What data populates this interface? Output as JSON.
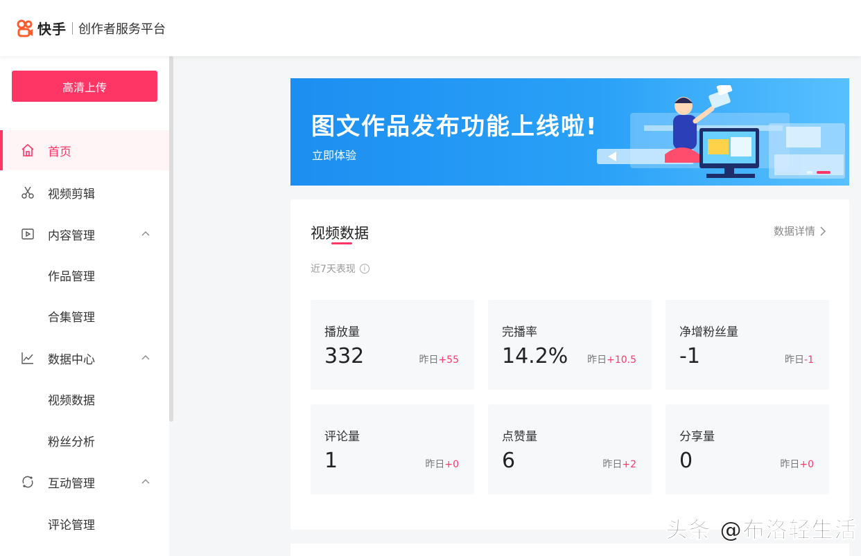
{
  "header": {
    "brand": "快手",
    "platform": "创作者服务平台"
  },
  "sidebar": {
    "upload_label": "高清上传",
    "items": [
      {
        "label": "首页",
        "icon": "home-icon",
        "active": true
      },
      {
        "label": "视频剪辑",
        "icon": "scissors-icon"
      },
      {
        "label": "内容管理",
        "icon": "play-square-icon",
        "expanded": true
      },
      {
        "label": "作品管理",
        "sub": true
      },
      {
        "label": "合集管理",
        "sub": true
      },
      {
        "label": "数据中心",
        "icon": "line-chart-icon",
        "expanded": true
      },
      {
        "label": "视频数据",
        "sub": true
      },
      {
        "label": "粉丝分析",
        "sub": true
      },
      {
        "label": "互动管理",
        "icon": "interaction-icon",
        "expanded": true
      },
      {
        "label": "评论管理",
        "sub": true
      }
    ]
  },
  "banner": {
    "title": "图文作品发布功能上线啦!",
    "subtitle": "立即体验"
  },
  "video_data": {
    "title": "视频数据",
    "detail_link": "数据详情",
    "period": "近7天表现",
    "yesterday_label": "昨日",
    "stats": [
      {
        "label": "播放量",
        "value": "332",
        "delta": "+55"
      },
      {
        "label": "完播率",
        "value": "14.2%",
        "delta": "+10.5"
      },
      {
        "label": "净增粉丝量",
        "value": "-1",
        "delta": "-1"
      },
      {
        "label": "评论量",
        "value": "1",
        "delta": "+0"
      },
      {
        "label": "点赞量",
        "value": "6",
        "delta": "+2"
      },
      {
        "label": "分享量",
        "value": "0",
        "delta": "+0"
      }
    ]
  },
  "watermark": "头条 @布洛轻生活",
  "colors": {
    "accent": "#fe3666",
    "banner": "#1c8ef1"
  }
}
